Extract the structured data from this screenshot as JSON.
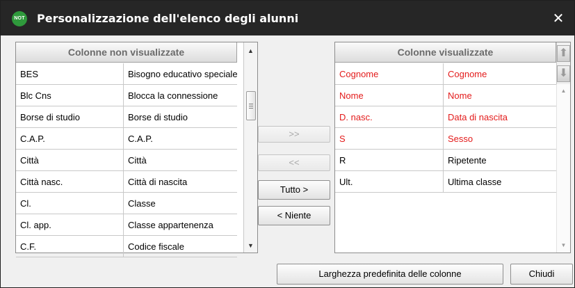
{
  "window": {
    "badge": "NOT",
    "title": "Personalizzazione dell'elenco degli alunni",
    "close_glyph": "✕"
  },
  "left_grid": {
    "header": "Colonne non visualizzate",
    "rows": [
      {
        "code": "BES",
        "label": "Bisogno educativo speciale"
      },
      {
        "code": "Blc Cns",
        "label": "Blocca la connessione"
      },
      {
        "code": "Borse di studio",
        "label": "Borse di studio"
      },
      {
        "code": "C.A.P.",
        "label": "C.A.P."
      },
      {
        "code": "Città",
        "label": "Città"
      },
      {
        "code": "Città nasc.",
        "label": "Città di nascita"
      },
      {
        "code": "Cl.",
        "label": "Classe"
      },
      {
        "code": "Cl. app.",
        "label": "Classe appartenenza"
      },
      {
        "code": "C.F.",
        "label": "Codice fiscale"
      }
    ],
    "scroll_up": "▲",
    "scroll_down": "▼"
  },
  "right_grid": {
    "header": "Colonne visualizzate",
    "rows": [
      {
        "code": "Cognome",
        "label": "Cognome",
        "required": true
      },
      {
        "code": "Nome",
        "label": "Nome",
        "required": true
      },
      {
        "code": "D. nasc.",
        "label": "Data di nascita",
        "required": true
      },
      {
        "code": "S",
        "label": "Sesso",
        "required": true
      },
      {
        "code": "R",
        "label": "Ripetente",
        "required": false
      },
      {
        "code": "Ult.",
        "label": "Ultima classe",
        "required": false
      }
    ],
    "move_up": "⬆",
    "move_down": "⬇",
    "scroll_up": "▲",
    "scroll_down": "▼"
  },
  "transfer": {
    "add_label": ">>",
    "remove_label": "<<",
    "all_label": "Tutto >",
    "none_label": "< Niente"
  },
  "footer": {
    "default_width_label": "Larghezza predefinita delle colonne",
    "close_label": "Chiudi"
  },
  "colors": {
    "titlebar": "#262626",
    "badge": "#2f9a3c",
    "required_text": "#e31b1b"
  }
}
